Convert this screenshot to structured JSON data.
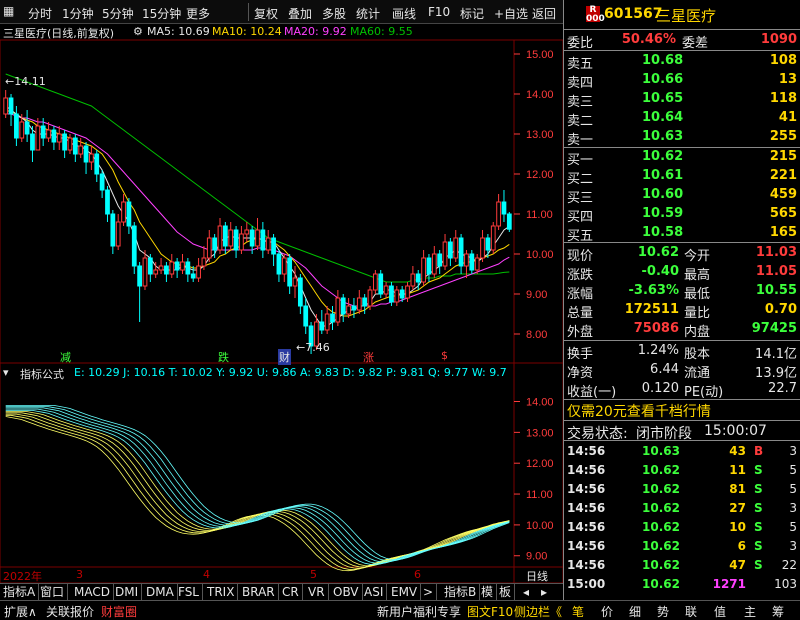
{
  "toolbar": {
    "period_items": [
      "分时",
      "1分钟",
      "5分钟",
      "15分钟",
      "更多"
    ],
    "right_items": [
      "复权",
      "叠加",
      "多股",
      "统计",
      "画线",
      "F10",
      "标记",
      "+自选",
      "返回"
    ]
  },
  "info": {
    "stock_title": "三星医疗(日线,前复权)",
    "ma5": "MA5: 10.69",
    "ma10": "MA10: 10.24",
    "ma20": "MA20: 9.92",
    "ma60": "MA60: 9.55"
  },
  "colors": {
    "up": "#ff3c3c",
    "down": "#00ffff",
    "ma5": "#e6e6e6",
    "ma10": "#ffd700",
    "ma20": "#ff40ff",
    "ma60": "#00c000",
    "grid": "#7a0000",
    "price_axis": "#ff3c3c"
  },
  "chart": {
    "price_ticks": [
      "15.00",
      "14.00",
      "13.00",
      "12.00",
      "11.00",
      "10.00",
      "9.00",
      "8.00"
    ],
    "high_label": "14.11",
    "low_label": "7.46",
    "signals": [
      {
        "text": "减"
      },
      {
        "text": "跌"
      },
      {
        "text": "财"
      },
      {
        "text": "涨"
      },
      {
        "text": "$"
      }
    ],
    "indicator_ticks": [
      "14.00",
      "13.00",
      "12.00",
      "11.00",
      "10.00",
      "9.00"
    ]
  },
  "chart_data": {
    "type": "candlestick",
    "ylim": [
      7.3,
      15.3
    ],
    "candles": [
      {
        "o": 13.5,
        "c": 13.9,
        "h": 14.1,
        "l": 13.4
      },
      {
        "o": 13.9,
        "c": 13.5,
        "h": 14.0,
        "l": 13.2
      },
      {
        "o": 13.5,
        "c": 12.9,
        "h": 13.7,
        "l": 12.7
      },
      {
        "o": 12.9,
        "c": 13.3,
        "h": 13.5,
        "l": 12.8
      },
      {
        "o": 13.3,
        "c": 13.0,
        "h": 13.6,
        "l": 12.8
      },
      {
        "o": 13.0,
        "c": 12.6,
        "h": 13.2,
        "l": 12.3
      },
      {
        "o": 12.6,
        "c": 13.2,
        "h": 13.4,
        "l": 12.6
      },
      {
        "o": 13.2,
        "c": 12.9,
        "h": 13.4,
        "l": 12.7
      },
      {
        "o": 12.9,
        "c": 13.1,
        "h": 13.3,
        "l": 12.8
      },
      {
        "o": 13.1,
        "c": 12.8,
        "h": 13.2,
        "l": 12.6
      },
      {
        "o": 12.8,
        "c": 13.0,
        "h": 13.2,
        "l": 12.6
      },
      {
        "o": 13.0,
        "c": 12.6,
        "h": 13.1,
        "l": 12.4
      },
      {
        "o": 12.6,
        "c": 12.9,
        "h": 13.0,
        "l": 12.5
      },
      {
        "o": 12.9,
        "c": 12.5,
        "h": 13.0,
        "l": 12.3
      },
      {
        "o": 12.5,
        "c": 12.7,
        "h": 12.9,
        "l": 12.4
      },
      {
        "o": 12.7,
        "c": 12.3,
        "h": 12.8,
        "l": 12.0
      },
      {
        "o": 12.3,
        "c": 12.5,
        "h": 12.7,
        "l": 12.1
      },
      {
        "o": 12.5,
        "c": 12.0,
        "h": 12.6,
        "l": 11.8
      },
      {
        "o": 12.0,
        "c": 11.6,
        "h": 12.1,
        "l": 11.4
      },
      {
        "o": 11.6,
        "c": 11.0,
        "h": 11.7,
        "l": 10.8
      },
      {
        "o": 11.0,
        "c": 10.2,
        "h": 11.1,
        "l": 10.0
      },
      {
        "o": 10.2,
        "c": 10.8,
        "h": 11.0,
        "l": 10.1
      },
      {
        "o": 10.8,
        "c": 11.3,
        "h": 11.5,
        "l": 10.7
      },
      {
        "o": 11.3,
        "c": 10.7,
        "h": 11.4,
        "l": 10.5
      },
      {
        "o": 10.7,
        "c": 9.7,
        "h": 10.8,
        "l": 9.5
      },
      {
        "o": 9.7,
        "c": 9.2,
        "h": 9.8,
        "l": 8.3
      },
      {
        "o": 9.2,
        "c": 9.9,
        "h": 10.1,
        "l": 9.1
      },
      {
        "o": 9.9,
        "c": 9.5,
        "h": 10.0,
        "l": 9.3
      },
      {
        "o": 9.5,
        "c": 9.6,
        "h": 9.8,
        "l": 9.4
      },
      {
        "o": 9.6,
        "c": 9.7,
        "h": 9.9,
        "l": 9.5
      },
      {
        "o": 9.7,
        "c": 9.5,
        "h": 9.8,
        "l": 9.3
      },
      {
        "o": 9.5,
        "c": 9.8,
        "h": 10.0,
        "l": 9.4
      },
      {
        "o": 9.8,
        "c": 9.6,
        "h": 9.9,
        "l": 9.4
      },
      {
        "o": 9.6,
        "c": 9.8,
        "h": 10.0,
        "l": 9.5
      },
      {
        "o": 9.8,
        "c": 9.5,
        "h": 9.9,
        "l": 9.3
      },
      {
        "o": 9.5,
        "c": 9.4,
        "h": 9.7,
        "l": 9.3
      },
      {
        "o": 9.4,
        "c": 9.7,
        "h": 9.9,
        "l": 9.3
      },
      {
        "o": 9.7,
        "c": 9.9,
        "h": 10.2,
        "l": 9.6
      },
      {
        "o": 9.9,
        "c": 10.4,
        "h": 10.6,
        "l": 9.8
      },
      {
        "o": 10.4,
        "c": 10.1,
        "h": 10.5,
        "l": 9.9
      },
      {
        "o": 10.1,
        "c": 10.7,
        "h": 10.9,
        "l": 10.0
      },
      {
        "o": 10.7,
        "c": 10.2,
        "h": 10.8,
        "l": 10.0
      },
      {
        "o": 10.2,
        "c": 10.6,
        "h": 10.8,
        "l": 10.1
      },
      {
        "o": 10.6,
        "c": 10.1,
        "h": 10.7,
        "l": 9.9
      },
      {
        "o": 10.1,
        "c": 10.5,
        "h": 10.7,
        "l": 10.0
      },
      {
        "o": 10.5,
        "c": 10.6,
        "h": 10.8,
        "l": 10.3
      },
      {
        "o": 10.6,
        "c": 10.2,
        "h": 10.7,
        "l": 10.0
      },
      {
        "o": 10.2,
        "c": 10.6,
        "h": 10.9,
        "l": 10.1
      },
      {
        "o": 10.6,
        "c": 10.1,
        "h": 10.8,
        "l": 9.9
      },
      {
        "o": 10.1,
        "c": 10.4,
        "h": 10.6,
        "l": 10.0
      },
      {
        "o": 10.4,
        "c": 10.0,
        "h": 10.5,
        "l": 9.7
      },
      {
        "o": 10.0,
        "c": 9.5,
        "h": 10.1,
        "l": 9.3
      },
      {
        "o": 9.5,
        "c": 9.9,
        "h": 10.0,
        "l": 9.3
      },
      {
        "o": 9.9,
        "c": 9.2,
        "h": 10.0,
        "l": 9.0
      },
      {
        "o": 9.2,
        "c": 9.4,
        "h": 9.7,
        "l": 8.9
      },
      {
        "o": 9.4,
        "c": 8.7,
        "h": 9.5,
        "l": 8.5
      },
      {
        "o": 8.7,
        "c": 8.2,
        "h": 8.9,
        "l": 8.0
      },
      {
        "o": 8.2,
        "c": 7.7,
        "h": 8.3,
        "l": 7.5
      },
      {
        "o": 7.7,
        "c": 8.3,
        "h": 8.5,
        "l": 7.6
      },
      {
        "o": 8.3,
        "c": 8.1,
        "h": 8.6,
        "l": 8.0
      },
      {
        "o": 8.1,
        "c": 8.5,
        "h": 8.7,
        "l": 8.0
      },
      {
        "o": 8.5,
        "c": 8.3,
        "h": 8.7,
        "l": 8.1
      },
      {
        "o": 8.3,
        "c": 8.9,
        "h": 9.1,
        "l": 8.2
      },
      {
        "o": 8.9,
        "c": 8.5,
        "h": 9.0,
        "l": 8.3
      },
      {
        "o": 8.5,
        "c": 8.7,
        "h": 8.9,
        "l": 8.4
      },
      {
        "o": 8.7,
        "c": 8.6,
        "h": 8.9,
        "l": 8.4
      },
      {
        "o": 8.6,
        "c": 8.9,
        "h": 9.1,
        "l": 8.5
      },
      {
        "o": 8.9,
        "c": 8.7,
        "h": 9.0,
        "l": 8.5
      },
      {
        "o": 8.7,
        "c": 9.1,
        "h": 9.2,
        "l": 8.6
      },
      {
        "o": 9.1,
        "c": 9.5,
        "h": 9.6,
        "l": 9.0
      },
      {
        "o": 9.5,
        "c": 9.0,
        "h": 9.6,
        "l": 8.9
      },
      {
        "o": 9.0,
        "c": 9.2,
        "h": 9.3,
        "l": 8.9
      },
      {
        "o": 9.2,
        "c": 8.8,
        "h": 9.3,
        "l": 8.7
      },
      {
        "o": 8.8,
        "c": 9.1,
        "h": 9.2,
        "l": 8.7
      },
      {
        "o": 9.1,
        "c": 8.9,
        "h": 9.2,
        "l": 8.8
      },
      {
        "o": 8.9,
        "c": 9.2,
        "h": 9.3,
        "l": 8.8
      },
      {
        "o": 9.2,
        "c": 9.5,
        "h": 9.7,
        "l": 9.1
      },
      {
        "o": 9.5,
        "c": 9.3,
        "h": 9.6,
        "l": 9.1
      },
      {
        "o": 9.3,
        "c": 9.9,
        "h": 10.1,
        "l": 9.2
      },
      {
        "o": 9.9,
        "c": 9.5,
        "h": 10.0,
        "l": 9.3
      },
      {
        "o": 9.5,
        "c": 10.0,
        "h": 10.2,
        "l": 9.4
      },
      {
        "o": 10.0,
        "c": 9.7,
        "h": 10.1,
        "l": 9.5
      },
      {
        "o": 9.7,
        "c": 10.3,
        "h": 10.5,
        "l": 9.6
      },
      {
        "o": 10.3,
        "c": 9.9,
        "h": 10.4,
        "l": 9.7
      },
      {
        "o": 9.9,
        "c": 10.4,
        "h": 10.6,
        "l": 9.8
      },
      {
        "o": 10.4,
        "c": 9.7,
        "h": 10.5,
        "l": 9.5
      },
      {
        "o": 9.7,
        "c": 10.0,
        "h": 10.1,
        "l": 9.4
      },
      {
        "o": 10.0,
        "c": 9.6,
        "h": 10.1,
        "l": 9.5
      },
      {
        "o": 9.6,
        "c": 9.9,
        "h": 10.0,
        "l": 9.5
      },
      {
        "o": 9.9,
        "c": 10.4,
        "h": 10.6,
        "l": 9.8
      },
      {
        "o": 10.4,
        "c": 10.1,
        "h": 10.5,
        "l": 9.9
      },
      {
        "o": 10.1,
        "c": 10.7,
        "h": 10.8,
        "l": 10.0
      },
      {
        "o": 10.7,
        "c": 11.3,
        "h": 11.5,
        "l": 10.6
      },
      {
        "o": 11.3,
        "c": 11.0,
        "h": 11.6,
        "l": 10.8
      },
      {
        "o": 11.0,
        "c": 10.62,
        "h": 11.05,
        "l": 10.55
      }
    ],
    "ma5": [
      13.7,
      13.6,
      13.5,
      13.4,
      13.3,
      13.1,
      13.0,
      13.0,
      13.0,
      12.95,
      12.9,
      12.9,
      12.8,
      12.7,
      12.7,
      12.6,
      12.5,
      12.3,
      12.1,
      11.8,
      11.5,
      11.2,
      11.0,
      10.8,
      10.5,
      10.1,
      10.0,
      9.9,
      9.7,
      9.6,
      9.6,
      9.6,
      9.6,
      9.7,
      9.65,
      9.6,
      9.6,
      9.7,
      9.9,
      10.0,
      10.3,
      10.4,
      10.45,
      10.4,
      10.4,
      10.4,
      10.4,
      10.4,
      10.35,
      10.3,
      10.3,
      10.1,
      9.9,
      9.7,
      9.5,
      9.2,
      8.9,
      8.6,
      8.4,
      8.2,
      8.2,
      8.3,
      8.4,
      8.5,
      8.6,
      8.6,
      8.7,
      8.7,
      8.8,
      9.0,
      9.0,
      9.1,
      9.1,
      9.0,
      9.0,
      9.0,
      9.1,
      9.2,
      9.4,
      9.5,
      9.6,
      9.7,
      9.9,
      10.0,
      10.1,
      10.0,
      9.95,
      9.9,
      9.8,
      9.9,
      10.0,
      10.2,
      10.4,
      10.6,
      10.69
    ],
    "ma10": [
      13.6,
      13.55,
      13.5,
      13.4,
      13.35,
      13.3,
      13.2,
      13.15,
      13.1,
      13.05,
      13.0,
      12.95,
      12.9,
      12.85,
      12.8,
      12.75,
      12.7,
      12.6,
      12.5,
      12.3,
      12.1,
      11.8,
      11.55,
      11.3,
      11.1,
      10.8,
      10.6,
      10.4,
      10.2,
      10.0,
      9.9,
      9.8,
      9.75,
      9.7,
      9.7,
      9.65,
      9.65,
      9.7,
      9.75,
      9.8,
      9.95,
      10.0,
      10.1,
      10.15,
      10.2,
      10.3,
      10.35,
      10.4,
      10.35,
      10.3,
      10.3,
      10.2,
      10.1,
      9.95,
      9.8,
      9.6,
      9.4,
      9.2,
      9.0,
      8.8,
      8.65,
      8.55,
      8.5,
      8.45,
      8.45,
      8.5,
      8.55,
      8.6,
      8.7,
      8.8,
      8.85,
      8.9,
      8.95,
      8.95,
      9.0,
      9.0,
      9.05,
      9.1,
      9.2,
      9.3,
      9.35,
      9.4,
      9.5,
      9.6,
      9.7,
      9.75,
      9.8,
      9.8,
      9.85,
      9.9,
      9.95,
      10.0,
      10.1,
      10.15,
      10.24
    ],
    "ma20": [
      13.5,
      13.5,
      13.45,
      13.4,
      13.4,
      13.35,
      13.3,
      13.3,
      13.25,
      13.2,
      13.15,
      13.1,
      13.05,
      13.0,
      12.95,
      12.9,
      12.8,
      12.7,
      12.6,
      12.5,
      12.35,
      12.2,
      12.05,
      11.9,
      11.75,
      11.6,
      11.45,
      11.3,
      11.15,
      11.0,
      10.85,
      10.7,
      10.55,
      10.45,
      10.35,
      10.25,
      10.2,
      10.15,
      10.1,
      10.1,
      10.1,
      10.1,
      10.1,
      10.1,
      10.1,
      10.1,
      10.1,
      10.15,
      10.15,
      10.1,
      10.1,
      10.05,
      10.0,
      9.95,
      9.85,
      9.75,
      9.65,
      9.5,
      9.35,
      9.2,
      9.1,
      9.0,
      8.9,
      8.8,
      8.75,
      8.7,
      8.7,
      8.7,
      8.7,
      8.7,
      8.75,
      8.75,
      8.8,
      8.8,
      8.85,
      8.9,
      8.95,
      9.0,
      9.05,
      9.1,
      9.15,
      9.2,
      9.25,
      9.3,
      9.35,
      9.4,
      9.45,
      9.5,
      9.55,
      9.6,
      9.65,
      9.7,
      9.75,
      9.85,
      9.92
    ],
    "ma60": [
      14.5,
      14.45,
      14.4,
      14.35,
      14.3,
      14.25,
      14.2,
      14.15,
      14.1,
      14.05,
      14.0,
      13.95,
      13.9,
      13.85,
      13.8,
      13.75,
      13.7,
      13.6,
      13.5,
      13.4,
      13.3,
      13.2,
      13.1,
      13.0,
      12.9,
      12.8,
      12.7,
      12.6,
      12.5,
      12.4,
      12.3,
      12.2,
      12.1,
      12.0,
      11.9,
      11.8,
      11.7,
      11.6,
      11.5,
      11.4,
      11.3,
      11.2,
      11.1,
      11.0,
      10.9,
      10.8,
      10.7,
      10.6,
      10.5,
      10.4,
      10.35,
      10.3,
      10.25,
      10.2,
      10.15,
      10.1,
      10.05,
      10.0,
      9.95,
      9.9,
      9.85,
      9.8,
      9.75,
      9.7,
      9.65,
      9.6,
      9.55,
      9.5,
      9.45,
      9.4,
      9.35,
      9.3,
      9.3,
      9.3,
      9.3,
      9.3,
      9.35,
      9.35,
      9.4,
      9.4,
      9.4,
      9.45,
      9.45,
      9.45,
      9.5,
      9.5,
      9.5,
      9.5,
      9.5,
      9.5,
      9.5,
      9.5,
      9.52,
      9.54,
      9.55
    ]
  },
  "indicator": {
    "name": "指标公式",
    "values": "E: 10.29  J: 10.16  T: 10.02  Y: 9.92  U: 9.86  A: 9.83  D: 9.82  P: 9.81  Q: 9.77  W: 9.7"
  },
  "dates": {
    "year_label": "2022年",
    "months": [
      "3",
      "4",
      "5",
      "6"
    ],
    "right_label": "日线"
  },
  "tabs": [
    "指标A",
    "窗口",
    "MACD",
    "DMI",
    "DMA",
    "FSL",
    "TRIX",
    "BRAR",
    "CR",
    "VR",
    "OBV",
    "ASI",
    "EMV",
    ">",
    "指标B",
    "模",
    "板"
  ],
  "bottom": {
    "items": [
      "扩展∧",
      "关联报价",
      "财富圈"
    ],
    "right_items": [
      "新用户福利专享",
      "图文F10",
      "侧边栏《"
    ]
  },
  "quote": {
    "code": "601567",
    "name": "三星医疗",
    "badge": "R",
    "weibi_label": "委比",
    "weibi_value": "50.46%",
    "weicha_label": "委差",
    "weicha_value": "1090",
    "asks": [
      {
        "label": "卖五",
        "price": "10.68",
        "vol": "108"
      },
      {
        "label": "卖四",
        "price": "10.66",
        "vol": "13"
      },
      {
        "label": "卖三",
        "price": "10.65",
        "vol": "118"
      },
      {
        "label": "卖二",
        "price": "10.64",
        "vol": "41"
      },
      {
        "label": "卖一",
        "price": "10.63",
        "vol": "255"
      }
    ],
    "bids": [
      {
        "label": "买一",
        "price": "10.62",
        "vol": "215"
      },
      {
        "label": "买二",
        "price": "10.61",
        "vol": "221"
      },
      {
        "label": "买三",
        "price": "10.60",
        "vol": "459"
      },
      {
        "label": "买四",
        "price": "10.59",
        "vol": "565"
      },
      {
        "label": "买五",
        "price": "10.58",
        "vol": "165"
      }
    ],
    "stats": [
      {
        "l1": "现价",
        "v1": "10.62",
        "c1": "green",
        "l2": "今开",
        "v2": "11.03",
        "c2": "red"
      },
      {
        "l1": "涨跌",
        "v1": "-0.40",
        "c1": "green",
        "l2": "最高",
        "v2": "11.05",
        "c2": "red"
      },
      {
        "l1": "涨幅",
        "v1": "-3.63%",
        "c1": "green",
        "l2": "最低",
        "v2": "10.55",
        "c2": "green"
      },
      {
        "l1": "总量",
        "v1": "172511",
        "c1": "yellow",
        "l2": "量比",
        "v2": "0.70",
        "c2": "yellow"
      },
      {
        "l1": "外盘",
        "v1": "75086",
        "c1": "red",
        "l2": "内盘",
        "v2": "97425",
        "c2": "green"
      }
    ],
    "stats2": [
      {
        "l1": "换手",
        "v1": "1.24%",
        "l2": "股本",
        "v2": "14.1亿"
      },
      {
        "l1": "净资",
        "v1": "6.44",
        "l2": "流通",
        "v2": "13.9亿"
      },
      {
        "l1": "收益(一)",
        "v1": "0.120",
        "l2": "PE(动)",
        "v2": "22.7"
      }
    ],
    "promo": "仅需20元查看千档行情",
    "status_label": "交易状态:",
    "status_value": "闭市阶段",
    "status_time": "15:00:07",
    "ticks": [
      {
        "time": "14:56",
        "price": "10.63",
        "pc": "green",
        "vol": "43",
        "vc": "yellow",
        "side": "B",
        "sc": "red",
        "num": "3"
      },
      {
        "time": "14:56",
        "price": "10.62",
        "pc": "green",
        "vol": "11",
        "vc": "yellow",
        "side": "S",
        "sc": "green",
        "num": "5"
      },
      {
        "time": "14:56",
        "price": "10.62",
        "pc": "green",
        "vol": "81",
        "vc": "yellow",
        "side": "S",
        "sc": "green",
        "num": "5"
      },
      {
        "time": "14:56",
        "price": "10.62",
        "pc": "green",
        "vol": "27",
        "vc": "yellow",
        "side": "S",
        "sc": "green",
        "num": "3"
      },
      {
        "time": "14:56",
        "price": "10.62",
        "pc": "green",
        "vol": "10",
        "vc": "yellow",
        "side": "S",
        "sc": "green",
        "num": "5"
      },
      {
        "time": "14:56",
        "price": "10.62",
        "pc": "green",
        "vol": "6",
        "vc": "yellow",
        "side": "S",
        "sc": "green",
        "num": "3"
      },
      {
        "time": "14:56",
        "price": "10.62",
        "pc": "green",
        "vol": "47",
        "vc": "yellow",
        "side": "S",
        "sc": "green",
        "num": "22"
      },
      {
        "time": "15:00",
        "price": "10.62",
        "pc": "green",
        "vol": "1271",
        "vc": "magenta",
        "side": "",
        "sc": "green",
        "num": "103"
      }
    ],
    "nav": [
      "笔",
      "价",
      "细",
      "势",
      "联",
      "值",
      "主",
      "筹"
    ]
  }
}
